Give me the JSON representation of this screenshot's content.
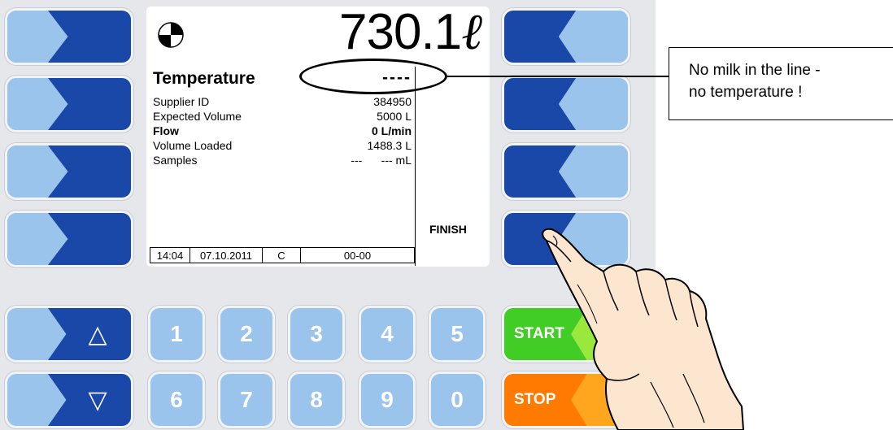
{
  "screen": {
    "volume": "730.1",
    "volume_unit": "ℓ",
    "temperature_label": "Temperature",
    "temperature_value": "----",
    "rows": [
      {
        "label": "Supplier ID",
        "value": "384950"
      },
      {
        "label": "Expected Volume",
        "value": "5000 L"
      },
      {
        "label": "Flow",
        "value": "0 L/min"
      },
      {
        "label": "Volume Loaded",
        "value": "1488.3 L"
      },
      {
        "label": "Samples",
        "value": "---      --- mL"
      }
    ],
    "finish_label": "FINISH",
    "status": {
      "time": "14:04",
      "date": "07.10.2011",
      "mode": "C",
      "code": "00-00"
    }
  },
  "keypad": {
    "up_arrow": "△",
    "down_arrow": "▽",
    "numbers_top": [
      "1",
      "2",
      "3",
      "4",
      "5"
    ],
    "numbers_bottom": [
      "6",
      "7",
      "8",
      "9",
      "0"
    ],
    "start_label": "START",
    "stop_label": "STOP"
  },
  "annotation": {
    "callout_line1": "No milk in the line -",
    "callout_line2": "no temperature !"
  },
  "colors": {
    "key_dark_blue": "#1a48a8",
    "key_light_blue": "#9ac4ec",
    "start_green": "#42cc26",
    "stop_orange": "#ff7a00"
  }
}
